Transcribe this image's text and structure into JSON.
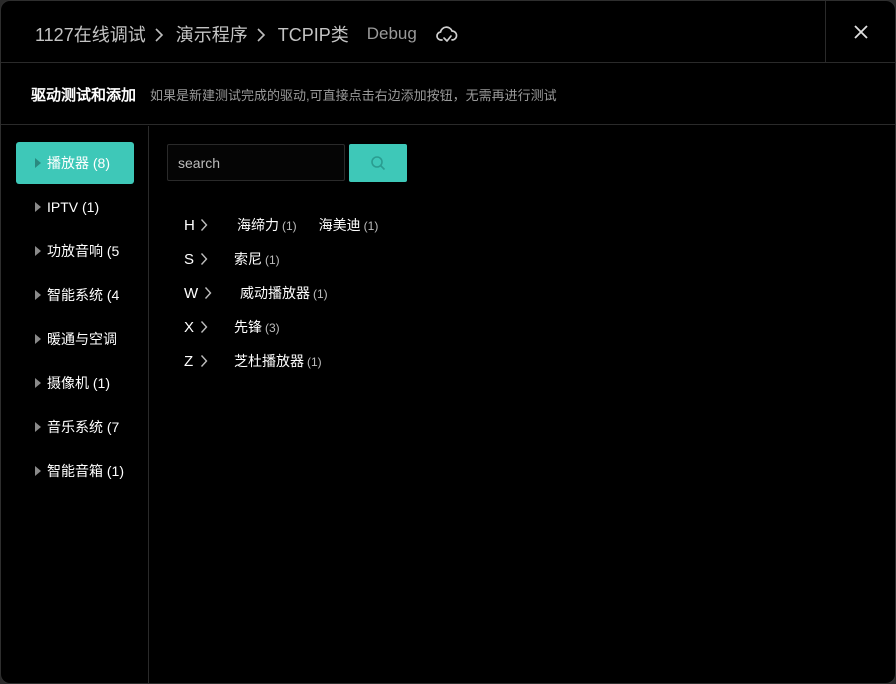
{
  "breadcrumb": [
    "1127在线调试",
    "演示程序",
    "TCPIP类"
  ],
  "debug_label": "Debug",
  "icons": {
    "cloud": "cloud-upload-icon",
    "close": "close-icon",
    "search": "search-icon"
  },
  "subheader": {
    "title": "驱动测试和添加",
    "description": "如果是新建测试完成的驱动,可直接点击右边添加按钮，无需再进行测试"
  },
  "sidebar": {
    "items": [
      {
        "label": "播放器 (8)",
        "active": true
      },
      {
        "label": "IPTV (1)"
      },
      {
        "label": "功放音响 (5"
      },
      {
        "label": "智能系统 (4"
      },
      {
        "label": "暖通与空调"
      },
      {
        "label": "摄像机 (1)"
      },
      {
        "label": "音乐系统 (7"
      },
      {
        "label": "智能音箱 (1)"
      }
    ]
  },
  "search": {
    "placeholder": "search",
    "value": ""
  },
  "brand_groups": [
    {
      "letter": "H",
      "brands": [
        {
          "name": "海缔力",
          "count": "(1)"
        },
        {
          "name": "海美迪",
          "count": "(1)"
        }
      ]
    },
    {
      "letter": "S",
      "brands": [
        {
          "name": "索尼",
          "count": "(1)"
        }
      ]
    },
    {
      "letter": "W",
      "brands": [
        {
          "name": "威动播放器",
          "count": "(1)"
        }
      ]
    },
    {
      "letter": "X",
      "brands": [
        {
          "name": "先锋",
          "count": "(3)"
        }
      ]
    },
    {
      "letter": "Z",
      "brands": [
        {
          "name": "芝杜播放器",
          "count": "(1)"
        }
      ]
    }
  ],
  "colors": {
    "accent": "#3ec8b8",
    "background": "#000000",
    "muted": "#9a9a9a"
  }
}
